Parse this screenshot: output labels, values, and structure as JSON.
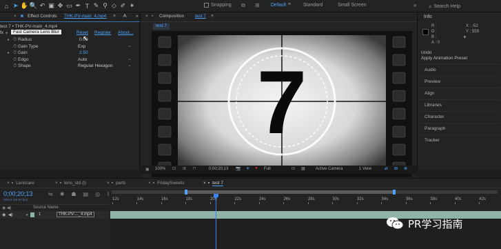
{
  "toolbar": {
    "tools": [
      {
        "icon": "home-icon",
        "glyph": "⌂"
      },
      {
        "icon": "selection-icon",
        "glyph": "➤"
      },
      {
        "icon": "hand-icon",
        "glyph": "✋"
      },
      {
        "icon": "zoom-icon",
        "glyph": "🔍"
      },
      {
        "icon": "rotate-icon",
        "glyph": "↶"
      },
      {
        "icon": "camera-icon",
        "glyph": "▣"
      },
      {
        "icon": "pan-behind-icon",
        "glyph": "✥"
      },
      {
        "icon": "rectangle-icon",
        "glyph": "▭"
      },
      {
        "icon": "pen-icon",
        "glyph": "✒"
      },
      {
        "icon": "type-icon",
        "glyph": "T"
      },
      {
        "icon": "brush-icon",
        "glyph": "✎"
      },
      {
        "icon": "clone-icon",
        "glyph": "⚲"
      },
      {
        "icon": "eraser-icon",
        "glyph": "◇"
      },
      {
        "icon": "roto-icon",
        "glyph": "✐"
      },
      {
        "icon": "puppet-icon",
        "glyph": "✶"
      }
    ],
    "snapping_label": "Snapping",
    "workspaces": [
      "Default",
      "Standard",
      "Small Screen"
    ],
    "workspace_menu_glyph": "≡",
    "overflow_glyph": "»",
    "search_placeholder": "Search Help"
  },
  "effect_controls": {
    "close_glyph": "×",
    "tab_title": "Effect Controls",
    "tab_file": "THK-PV-main_4.mp4",
    "panel_menu_glyph": "≡",
    "breadcrumb": "test 7 • THK-PV-main_4.mp4",
    "effect": {
      "fx_label": "fx",
      "name": "Fast Camera Lens Blur",
      "reset": "Reset",
      "register": "Register",
      "about": "About..."
    },
    "params": [
      {
        "name": "Radius",
        "value": "0.00",
        "type": "text",
        "blue": false
      },
      {
        "name": "Gain Type",
        "value": "Exp",
        "type": "select",
        "blue": false
      },
      {
        "name": "Gain",
        "value": "2.50",
        "type": "text",
        "blue": true
      },
      {
        "name": "Edgo",
        "value": "Auto",
        "type": "select",
        "blue": false
      },
      {
        "name": "Shape",
        "value": "Regular Hexagon",
        "type": "select",
        "blue": false
      }
    ]
  },
  "composition": {
    "close_glyph": "×",
    "tab_label": "Composition",
    "tab_comp": "test 7",
    "panel_menu_glyph": "≡",
    "subtab": "test 7",
    "countdown_number": "7",
    "zoom": "100%",
    "timecode": "0;00;20;13",
    "resolution": "Full",
    "camera": "Active Camera",
    "views": "1 View"
  },
  "right_panel": {
    "title": "Info",
    "r_label": "R :",
    "g_label": "G :",
    "b_label": "B :",
    "a_label": "A : 0",
    "x_label": "X : -52",
    "y_label": "Y : 559",
    "undo_label": "Undo",
    "undo_action": "Apply Animation Preset",
    "panels": [
      "Audio",
      "Preview",
      "Align",
      "Libraries",
      "Character",
      "Paragraph",
      "Tracker"
    ]
  },
  "timeline": {
    "tabs": [
      "Lenscare",
      "lens_std (l)",
      "parts",
      "FridaySweets",
      "test 7"
    ],
    "active_tab": "test 7",
    "close_glyph": "×",
    "timecode": "0;00;20;13",
    "timecode_sub": "00613 (29.97 fps)",
    "ruler": [
      "12s",
      "14s",
      "16s",
      "18s",
      "20s",
      "22s",
      "24s",
      "26s",
      "28s",
      "30s",
      "32s",
      "34s",
      "36s",
      "38s",
      "40s",
      "42s"
    ],
    "column_source": "Source Name",
    "layer_index": "1",
    "layer_name": "THK-PV-..._4.mp4",
    "current_time_s": 20.45,
    "ruler_start_s": 12,
    "ruler_end_s": 43.5
  },
  "watermark": {
    "text": "PR学习指南"
  },
  "colors": {
    "accent_blue": "#4fa3ff",
    "playhead": "#3b82f6",
    "layer_bar": "#8fb3a8"
  }
}
